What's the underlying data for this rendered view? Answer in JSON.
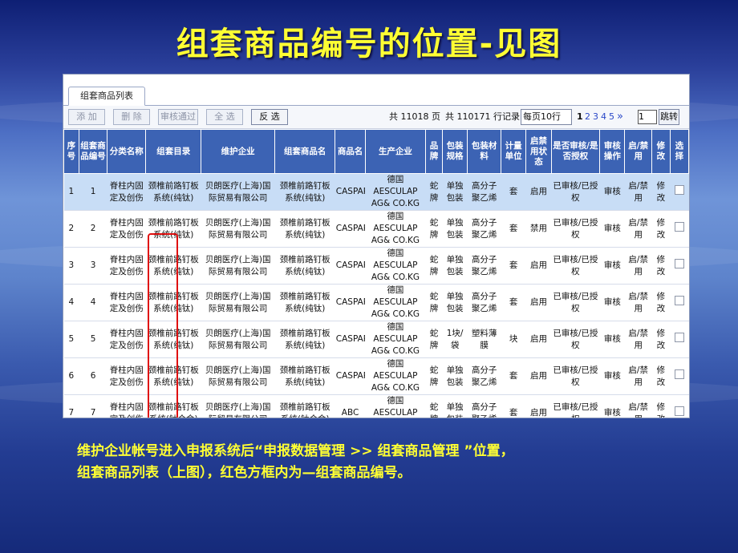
{
  "slide": {
    "title": "组套商品编号的位置-见图",
    "caption_line1": "维护企业帐号进入申报系统后“申报数据管理 >> 组套商品管理 ”位置，",
    "caption_line2": "组套商品列表（上图），红色方框内为—组套商品编号。"
  },
  "tab": {
    "label": "组套商品列表"
  },
  "toolbar": {
    "add": "添 加",
    "delete": "删 除",
    "approve": "审核通过",
    "select_all": "全 选",
    "invert": "反 选"
  },
  "pager": {
    "total_pages": "共 11018 页",
    "total_records": "共 110171 行记录",
    "page_size": "每页10行",
    "page_size_arrow": "▼",
    "pages": [
      "1",
      "2",
      "3",
      "4",
      "5"
    ],
    "next": "»",
    "input": "1",
    "jump": "跳转"
  },
  "columns": [
    "序号",
    "组套商品编号",
    "分类名称",
    "组套目录",
    "维护企业",
    "组套商品名",
    "商品名",
    "生产企业",
    "品牌",
    "包装规格",
    "包装材料",
    "计量单位",
    "启禁用状态",
    "是否审核/是否授权",
    "审核操作",
    "启/禁用",
    "修改",
    "选择"
  ],
  "rows": [
    {
      "no": "1",
      "code": "1",
      "cat": "脊柱内固定及创伤",
      "dir": "颈椎前路钉板系统(纯钛)",
      "ent": "贝朗医疗(上海)国际贸易有限公司",
      "name": "颈椎前路钉板系统(纯钛)",
      "brand_name": "CASPAR",
      "maker": "德国AESCULAP AG& CO.KG",
      "brand": "蛇牌",
      "spec": "单独包装",
      "mat": "高分子聚乙烯",
      "unit": "套",
      "status": "启用",
      "audit": "已审核/已授权",
      "op": "审核",
      "toggle": "启/禁用",
      "edit": "修改"
    },
    {
      "no": "2",
      "code": "2",
      "cat": "脊柱内固定及创伤",
      "dir": "颈椎前路钉板系统(纯钛)",
      "ent": "贝朗医疗(上海)国际贸易有限公司",
      "name": "颈椎前路钉板系统(纯钛)",
      "brand_name": "CASPAR",
      "maker": "德国AESCULAP AG& CO.KG",
      "brand": "蛇牌",
      "spec": "单独包装",
      "mat": "高分子聚乙烯",
      "unit": "套",
      "status": "禁用",
      "audit": "已审核/已授权",
      "op": "审核",
      "toggle": "启/禁用",
      "edit": "修改"
    },
    {
      "no": "3",
      "code": "3",
      "cat": "脊柱内固定及创伤",
      "dir": "颈椎前路钉板系统(纯钛)",
      "ent": "贝朗医疗(上海)国际贸易有限公司",
      "name": "颈椎前路钉板系统(纯钛)",
      "brand_name": "CASPAR",
      "maker": "德国AESCULAP AG& CO.KG",
      "brand": "蛇牌",
      "spec": "单独包装",
      "mat": "高分子聚乙烯",
      "unit": "套",
      "status": "启用",
      "audit": "已审核/已授权",
      "op": "审核",
      "toggle": "启/禁用",
      "edit": "修改"
    },
    {
      "no": "4",
      "code": "4",
      "cat": "脊柱内固定及创伤",
      "dir": "颈椎前路钉板系统(纯钛)",
      "ent": "贝朗医疗(上海)国际贸易有限公司",
      "name": "颈椎前路钉板系统(纯钛)",
      "brand_name": "CASPAR",
      "maker": "德国AESCULAP AG& CO.KG",
      "brand": "蛇牌",
      "spec": "单独包装",
      "mat": "高分子聚乙烯",
      "unit": "套",
      "status": "启用",
      "audit": "已审核/已授权",
      "op": "审核",
      "toggle": "启/禁用",
      "edit": "修改"
    },
    {
      "no": "5",
      "code": "5",
      "cat": "脊柱内固定及创伤",
      "dir": "颈椎前路钉板系统(纯钛)",
      "ent": "贝朗医疗(上海)国际贸易有限公司",
      "name": "颈椎前路钉板系统(纯钛)",
      "brand_name": "CASPAR",
      "maker": "德国AESCULAP AG& CO.KG",
      "brand": "蛇牌",
      "spec": "1块/袋",
      "mat": "塑料薄膜",
      "unit": "块",
      "status": "启用",
      "audit": "已审核/已授权",
      "op": "审核",
      "toggle": "启/禁用",
      "edit": "修改"
    },
    {
      "no": "6",
      "code": "6",
      "cat": "脊柱内固定及创伤",
      "dir": "颈椎前路钉板系统(纯钛)",
      "ent": "贝朗医疗(上海)国际贸易有限公司",
      "name": "颈椎前路钉板系统(纯钛)",
      "brand_name": "CASPAR",
      "maker": "德国AESCULAP AG& CO.KG",
      "brand": "蛇牌",
      "spec": "单独包装",
      "mat": "高分子聚乙烯",
      "unit": "套",
      "status": "启用",
      "audit": "已审核/已授权",
      "op": "审核",
      "toggle": "启/禁用",
      "edit": "修改"
    },
    {
      "no": "7",
      "code": "7",
      "cat": "脊柱内固定及创伤",
      "dir": "颈椎前路钉板系统(钛合金)",
      "ent": "贝朗医疗(上海)国际贸易有限公司",
      "name": "颈椎前路钉板系统(钛合金)",
      "brand_name": "ABC",
      "maker": "德国AESCULAP AG& CO.KG",
      "brand": "蛇牌",
      "spec": "单独包装",
      "mat": "高分子聚乙烯",
      "unit": "套",
      "status": "启用",
      "audit": "已审核/已授权",
      "op": "审核",
      "toggle": "启/禁用",
      "edit": "修改"
    }
  ]
}
